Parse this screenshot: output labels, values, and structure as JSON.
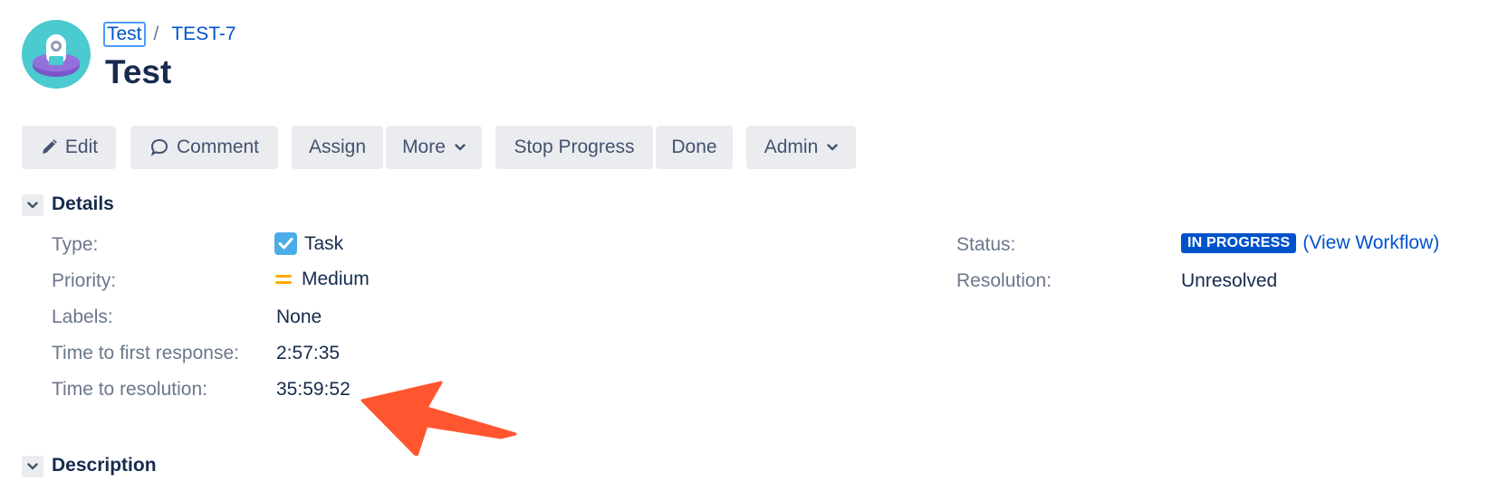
{
  "breadcrumb": {
    "project": "Test",
    "separator": "/",
    "issue_key": "TEST-7"
  },
  "issue": {
    "title": "Test"
  },
  "toolbar": {
    "edit": "Edit",
    "comment": "Comment",
    "assign": "Assign",
    "more": "More",
    "stop_progress": "Stop Progress",
    "done": "Done",
    "admin": "Admin"
  },
  "details": {
    "section_title": "Details",
    "type": {
      "label": "Type:",
      "value": "Task",
      "icon": "task-checkbox-icon"
    },
    "priority": {
      "label": "Priority:",
      "value": "Medium",
      "icon": "priority-medium-icon"
    },
    "labels": {
      "label": "Labels:",
      "value": "None"
    },
    "first_response": {
      "label": "Time to first response:",
      "value": "2:57:35"
    },
    "resolution_time": {
      "label": "Time to resolution:",
      "value": "35:59:52"
    },
    "status": {
      "label": "Status:",
      "value": "IN PROGRESS",
      "open_paren": "(",
      "link": "View Workflow",
      "close_paren": ")"
    },
    "resolution": {
      "label": "Resolution:",
      "value": "Unresolved"
    }
  },
  "description": {
    "section_title": "Description"
  },
  "colors": {
    "link": "#0052cc",
    "status_lozenge": "#0052cc",
    "button_bg": "#ebecf0",
    "priority_medium": "#ffab00",
    "task_icon": "#4bade8",
    "annotation_arrow": "#ff5630"
  }
}
